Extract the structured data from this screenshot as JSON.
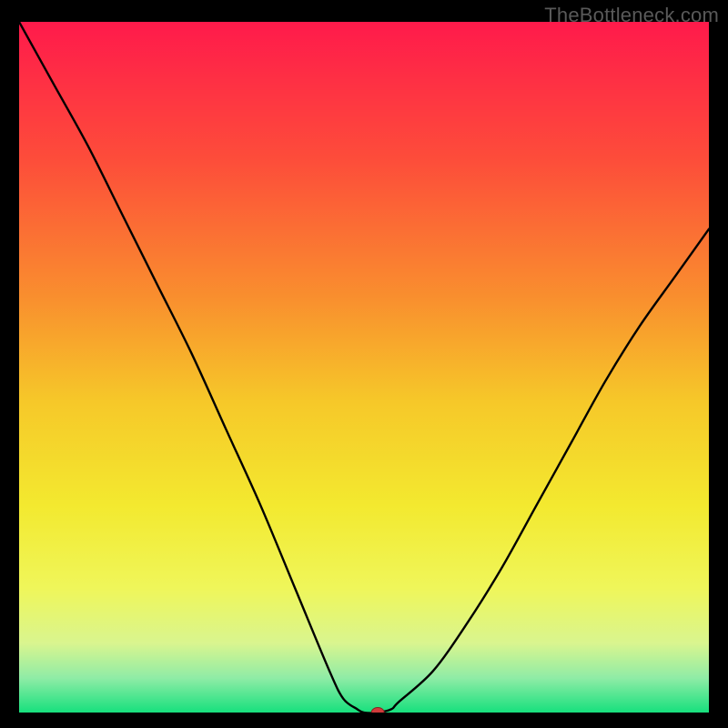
{
  "attribution": "TheBottleneck.com",
  "chart_data": {
    "type": "line",
    "title": "",
    "xlabel": "",
    "ylabel": "",
    "xlim": [
      0,
      100
    ],
    "ylim": [
      0,
      100
    ],
    "x": [
      0,
      5,
      10,
      15,
      20,
      25,
      30,
      35,
      40,
      45,
      47,
      49,
      50,
      52,
      54,
      55,
      60,
      65,
      70,
      75,
      80,
      85,
      90,
      95,
      100
    ],
    "y": [
      100,
      91,
      82,
      72,
      62,
      52,
      41,
      30,
      18,
      6,
      2,
      0.5,
      0,
      0,
      0.5,
      1.5,
      6,
      13,
      21,
      30,
      39,
      48,
      56,
      63,
      70
    ],
    "series": [
      {
        "name": "bottleneck-curve",
        "x": [
          0,
          5,
          10,
          15,
          20,
          25,
          30,
          35,
          40,
          45,
          47,
          49,
          50,
          52,
          54,
          55,
          60,
          65,
          70,
          75,
          80,
          85,
          90,
          95,
          100
        ],
        "y": [
          100,
          91,
          82,
          72,
          62,
          52,
          41,
          30,
          18,
          6,
          2,
          0.5,
          0,
          0,
          0.5,
          1.5,
          6,
          13,
          21,
          30,
          39,
          48,
          56,
          63,
          70
        ]
      }
    ],
    "marker": {
      "x": 52,
      "y": 0,
      "color": "#d13b3b"
    },
    "background_gradient": {
      "stops": [
        {
          "offset": 0.0,
          "color": "#ff1a4b"
        },
        {
          "offset": 0.2,
          "color": "#fd4d3a"
        },
        {
          "offset": 0.4,
          "color": "#f98f2e"
        },
        {
          "offset": 0.55,
          "color": "#f6c829"
        },
        {
          "offset": 0.7,
          "color": "#f3e92f"
        },
        {
          "offset": 0.82,
          "color": "#eff65a"
        },
        {
          "offset": 0.9,
          "color": "#d9f58f"
        },
        {
          "offset": 0.95,
          "color": "#8feca6"
        },
        {
          "offset": 1.0,
          "color": "#17e07d"
        }
      ]
    }
  }
}
